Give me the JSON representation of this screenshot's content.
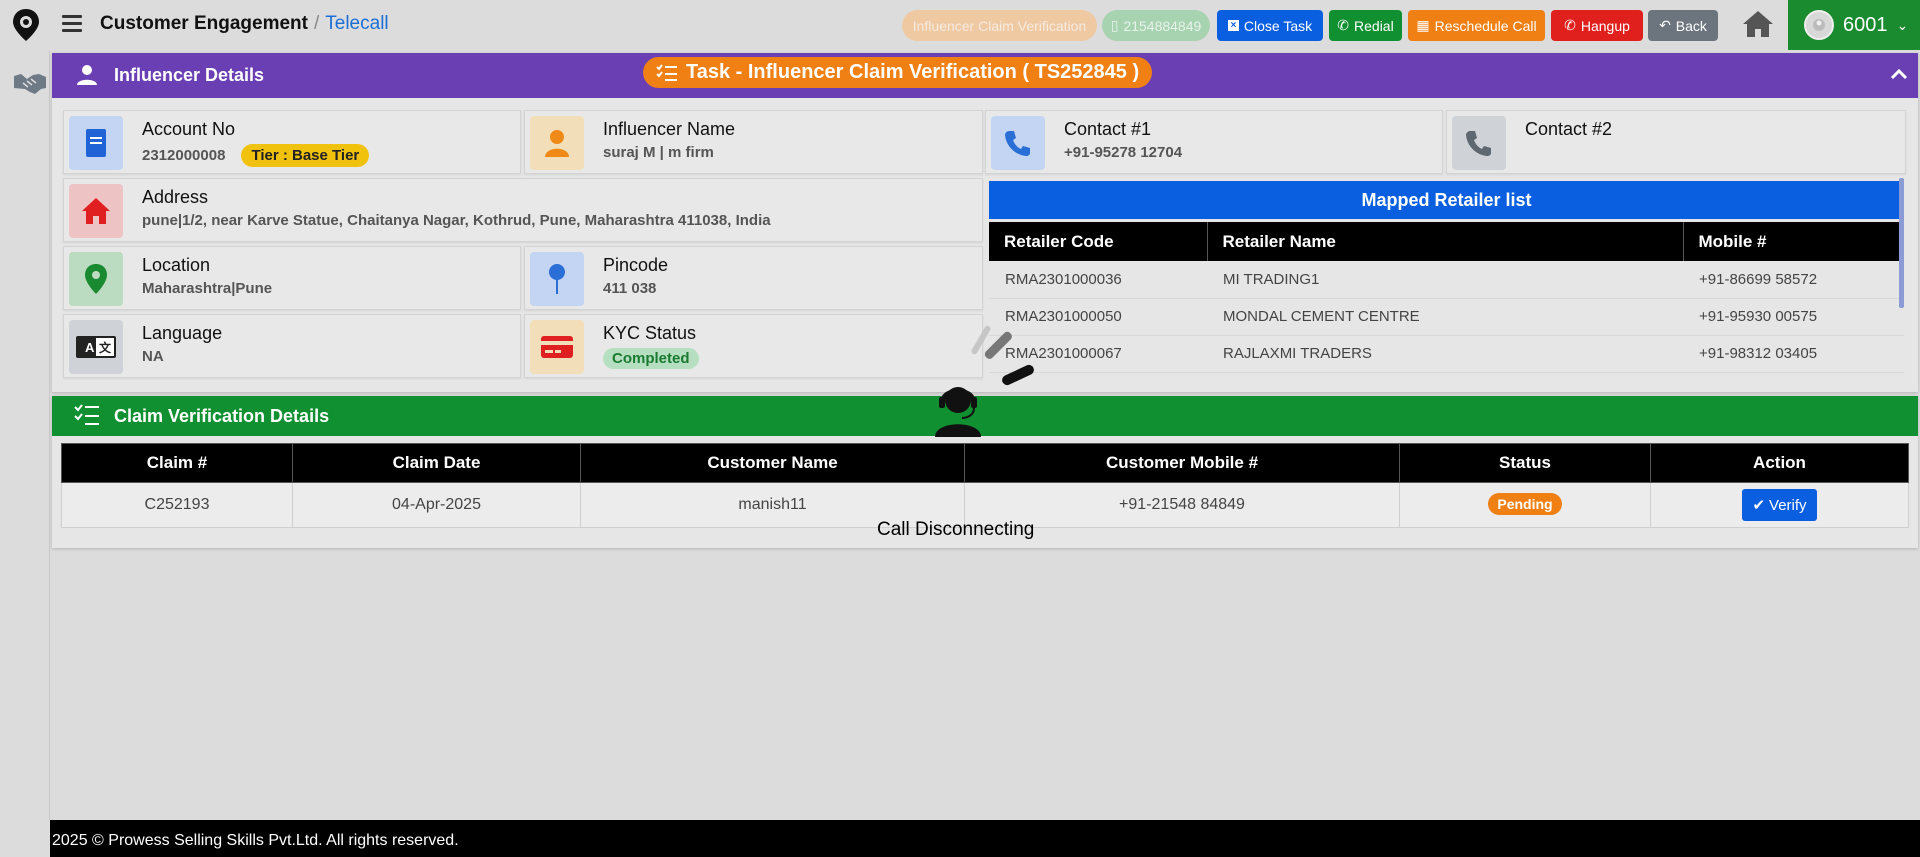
{
  "header": {
    "breadcrumb": {
      "module": "Customer Engagement",
      "separator": "/",
      "page": "Telecall"
    },
    "buttons": {
      "claim_verification": "Influencer Claim Verification",
      "phone": "2154884849",
      "close_task": "Close Task",
      "redial": "Redial",
      "reschedule": "Reschedule Call",
      "hangup": "Hangup",
      "back": "Back"
    },
    "user": {
      "id": "6001"
    }
  },
  "colors": {
    "influencer_header": "#6a3fb4",
    "task_pill": "#f07f14",
    "claim_header": "#119032",
    "retailer_header": "#0a5fe0",
    "user_box": "#1b8b2f",
    "close_task_btn": "#0a5fe0",
    "redial_btn": "#119032",
    "reschedule_btn": "#f07f14",
    "hangup_btn": "#e0201c",
    "back_btn": "#6c757d"
  },
  "influencer": {
    "title": "Influencer Details",
    "task_label": "Task - Influencer Claim Verification ( TS252845 )",
    "cards": {
      "account": {
        "label": "Account No",
        "value": "2312000008",
        "tier": "Tier : Base Tier"
      },
      "name": {
        "label": "Influencer Name",
        "value": "suraj M | m firm"
      },
      "contact1": {
        "label": "Contact #1",
        "value": "+91-95278 12704"
      },
      "contact2": {
        "label": "Contact #2",
        "value": ""
      },
      "address": {
        "label": "Address",
        "value": "pune|1/2, near Karve Statue, Chaitanya Nagar, Kothrud, Pune, Maharashtra 411038, India"
      },
      "location": {
        "label": "Location",
        "value": "Maharashtra|Pune"
      },
      "pincode": {
        "label": "Pincode",
        "value": "411 038"
      },
      "language": {
        "label": "Language",
        "value": "NA"
      },
      "kyc": {
        "label": "KYC Status",
        "value": "Completed"
      }
    }
  },
  "retailers": {
    "title": "Mapped Retailer list",
    "columns": [
      "Retailer Code",
      "Retailer Name",
      "Mobile #"
    ],
    "rows": [
      [
        "RMA2301000036",
        "MI TRADING1",
        "+91-86699 58572"
      ],
      [
        "RMA2301000050",
        "MONDAL CEMENT CENTRE",
        "+91-95930 00575"
      ],
      [
        "RMA2301000067",
        "RAJLAXMI TRADERS",
        "+91-98312 03405"
      ]
    ]
  },
  "claims": {
    "title": "Claim Verification Details",
    "columns": [
      "Claim #",
      "Claim Date",
      "Customer Name",
      "Customer Mobile #",
      "Status",
      "Action"
    ],
    "rows": [
      {
        "claim_no": "C252193",
        "date": "04-Apr-2025",
        "customer": "manish11",
        "mobile": "+91-21548 84849",
        "status": "Pending",
        "action": "Verify"
      }
    ]
  },
  "overlay": {
    "message": "Call Disconnecting"
  },
  "footer": {
    "text": "2025 © Prowess Selling Skills Pvt.Ltd. All rights reserved."
  }
}
